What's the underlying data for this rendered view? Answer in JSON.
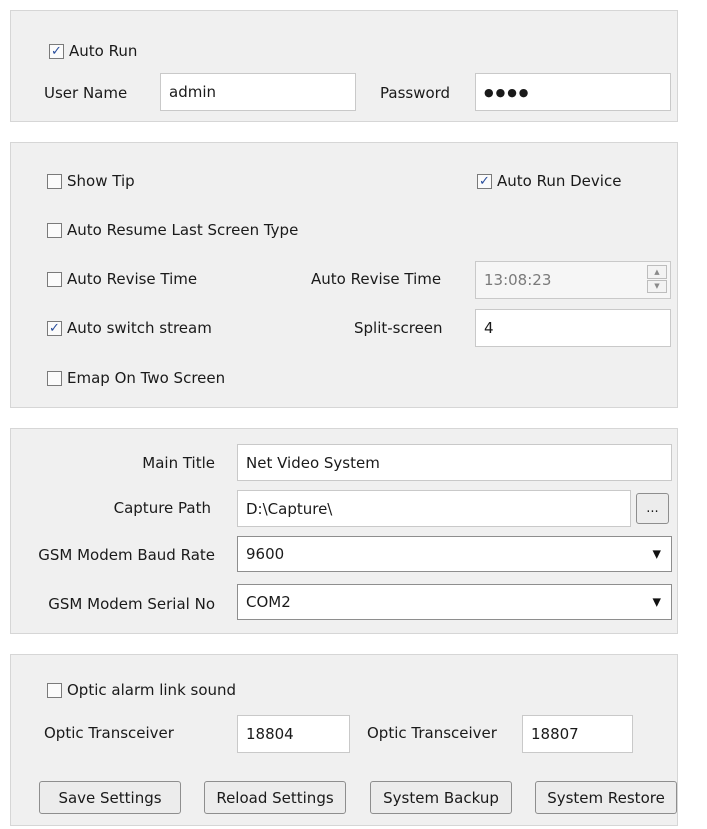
{
  "login": {
    "auto_run": {
      "label": "Auto Run",
      "checked": true
    },
    "username_label": "User Name",
    "username_value": "admin",
    "password_label": "Password",
    "password_value": "●●●●"
  },
  "options": {
    "show_tip": {
      "label": "Show Tip",
      "checked": false
    },
    "auto_run_device": {
      "label": "Auto Run Device",
      "checked": true
    },
    "auto_resume": {
      "label": "Auto Resume Last Screen Type",
      "checked": false
    },
    "auto_revise_time": {
      "label": "Auto Revise Time",
      "checked": false
    },
    "auto_revise_time_field_label": "Auto Revise Time",
    "auto_revise_time_value": "13:08:23",
    "auto_switch_stream": {
      "label": "Auto switch stream",
      "checked": true
    },
    "split_screen_label": "Split-screen",
    "split_screen_value": "4",
    "emap_two_screen": {
      "label": "Emap On Two Screen",
      "checked": false
    }
  },
  "system": {
    "main_title_label": "Main Title",
    "main_title_value": "Net Video System",
    "capture_path_label": "Capture Path",
    "capture_path_value": "D:\\Capture\\",
    "browse_label": "...",
    "baud_rate_label": "GSM Modem Baud Rate",
    "baud_rate_value": "9600",
    "serial_no_label": "GSM Modem Serial No",
    "serial_no_value": "COM2"
  },
  "optic": {
    "alarm_link_sound": {
      "label": "Optic alarm link sound",
      "checked": false
    },
    "transceiver1_label": "Optic Transceiver",
    "transceiver1_value": "18804",
    "transceiver2_label": "Optic Transceiver",
    "transceiver2_value": "18807"
  },
  "buttons": {
    "save": "Save Settings",
    "reload": "Reload Settings",
    "backup": "System Backup",
    "restore": "System Restore"
  },
  "icons": {
    "check": "✓",
    "spin_up": "▲",
    "spin_down": "▼",
    "dropdown": "▼"
  }
}
